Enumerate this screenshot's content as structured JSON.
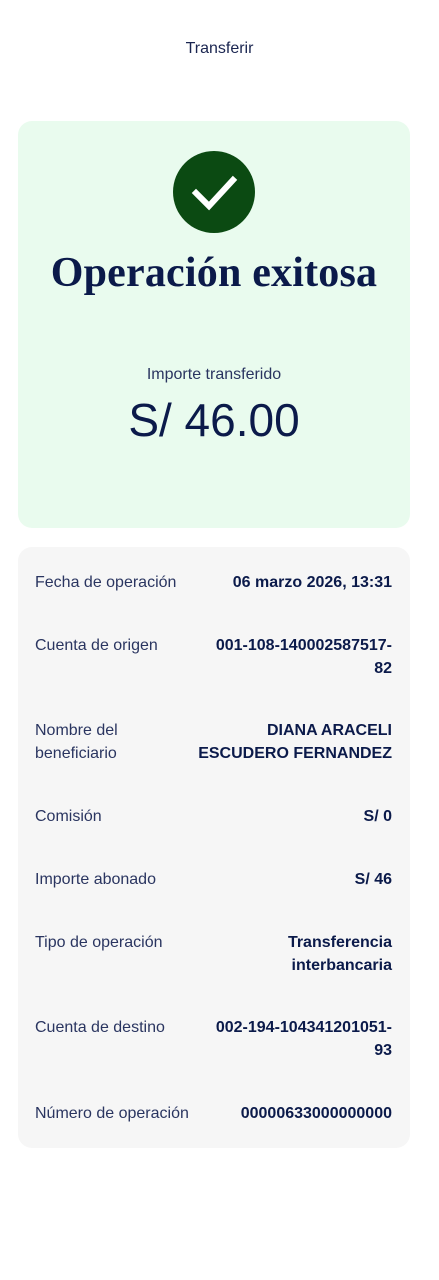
{
  "header": {
    "title": "Transferir"
  },
  "success": {
    "icon": "check-icon",
    "title": "Operación exitosa",
    "amount_label": "Importe transferido",
    "amount_value": "S/ 46.00",
    "colors": {
      "card_bg": "#e9fbee",
      "check_bg": "#0b4a12"
    }
  },
  "details": {
    "rows": [
      {
        "label": "Fecha de operación",
        "value": [
          "06 marzo 2026, 13:31"
        ]
      },
      {
        "label": "Cuenta de origen",
        "value": [
          "001-108-140002587517-",
          "82"
        ]
      },
      {
        "label": [
          "Nombre del",
          "beneficiario"
        ],
        "value": [
          "DIANA ARACELI",
          "ESCUDERO FERNANDEZ"
        ]
      },
      {
        "label": "Comisión",
        "value": [
          "S/ 0"
        ]
      },
      {
        "label": "Importe abonado",
        "value": [
          "S/ 46"
        ]
      },
      {
        "label": "Tipo de operación",
        "value": [
          "Transferencia",
          "interbancaria"
        ]
      },
      {
        "label": "Cuenta de destino",
        "value": [
          "002-194-104341201051-",
          "93"
        ]
      },
      {
        "label": "Número de operación",
        "value": [
          "00000633000000000"
        ]
      }
    ]
  }
}
